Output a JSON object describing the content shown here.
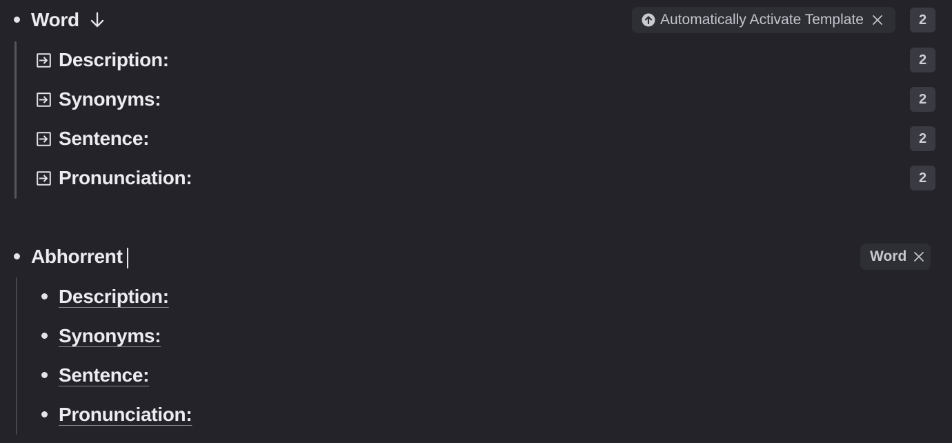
{
  "word_node": {
    "title": "Word",
    "arrow_icon": "arrow-down-icon",
    "count": "2",
    "tag": {
      "label": "Automatically Activate Template",
      "icon": "up-arrow-circle-icon",
      "remove_icon": "close-icon"
    },
    "fields": [
      {
        "label": "Description:",
        "count": "2",
        "icon": "field-icon"
      },
      {
        "label": "Synonyms:",
        "count": "2",
        "icon": "field-icon"
      },
      {
        "label": "Sentence:",
        "count": "2",
        "icon": "field-icon"
      },
      {
        "label": "Pronunciation:",
        "count": "2",
        "icon": "field-icon"
      }
    ]
  },
  "instance_node": {
    "title": "Abhorrent",
    "tag": {
      "label": "Word",
      "remove_icon": "close-icon"
    },
    "children": [
      {
        "label": "Description:"
      },
      {
        "label": "Synonyms:"
      },
      {
        "label": "Sentence:"
      },
      {
        "label": "Pronunciation:"
      }
    ]
  }
}
